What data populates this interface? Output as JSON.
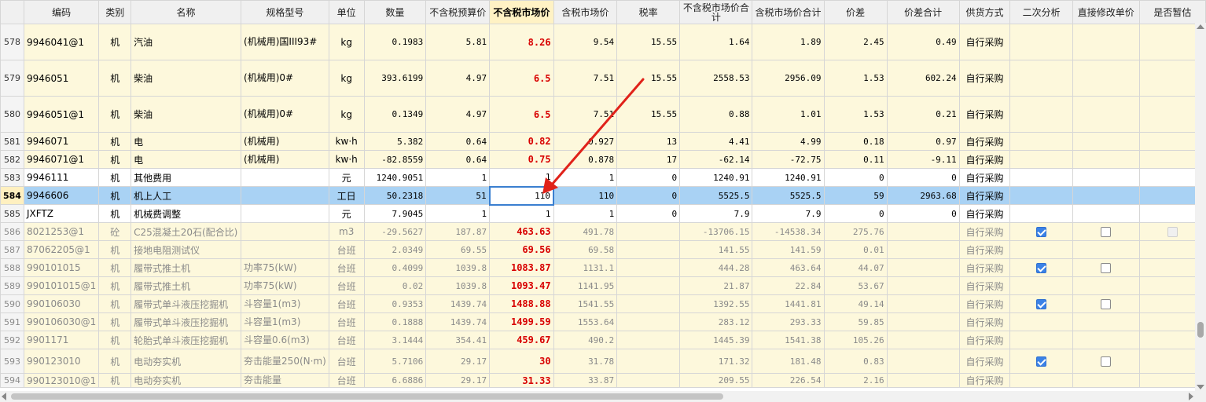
{
  "columns": [
    "编码",
    "类别",
    "名称",
    "规格型号",
    "单位",
    "数量",
    "不含税预算价",
    "不含税市场价",
    "含税市场价",
    "税率",
    "不含税市场价合计",
    "含税市场价合计",
    "价差",
    "价差合计",
    "供货方式",
    "二次分析",
    "直接修改单价",
    "是否暂估"
  ],
  "rows": [
    {
      "n": "578",
      "code": "9946041@1",
      "cat": "机",
      "name": "汽油",
      "spec": "(机械用)国III93#",
      "unit": "kg",
      "qty": "0.1983",
      "budget": "5.81",
      "market": "8.26",
      "taxed": "9.54",
      "rate": "15.55",
      "sum": "1.64",
      "sumtax": "1.89",
      "diff": "2.45",
      "diffsum": "0.49",
      "supply": "自行采购",
      "c1": "",
      "c2": "",
      "c3": ""
    },
    {
      "n": "579",
      "code": "9946051",
      "cat": "机",
      "name": "柴油",
      "spec": "(机械用)0#",
      "unit": "kg",
      "qty": "393.6199",
      "budget": "4.97",
      "market": "6.5",
      "taxed": "7.51",
      "rate": "15.55",
      "sum": "2558.53",
      "sumtax": "2956.09",
      "diff": "1.53",
      "diffsum": "602.24",
      "supply": "自行采购",
      "c1": "",
      "c2": "",
      "c3": ""
    },
    {
      "n": "580",
      "code": "9946051@1",
      "cat": "机",
      "name": "柴油",
      "spec": "(机械用)0#",
      "unit": "kg",
      "qty": "0.1349",
      "budget": "4.97",
      "market": "6.5",
      "taxed": "7.51",
      "rate": "15.55",
      "sum": "0.88",
      "sumtax": "1.01",
      "diff": "1.53",
      "diffsum": "0.21",
      "supply": "自行采购",
      "c1": "",
      "c2": "",
      "c3": ""
    },
    {
      "n": "581",
      "code": "9946071",
      "cat": "机",
      "name": "电",
      "spec": "(机械用)",
      "unit": "kw·h",
      "qty": "5.382",
      "budget": "0.64",
      "market": "0.82",
      "taxed": "0.927",
      "rate": "13",
      "sum": "4.41",
      "sumtax": "4.99",
      "diff": "0.18",
      "diffsum": "0.97",
      "supply": "自行采购",
      "c1": "",
      "c2": "",
      "c3": ""
    },
    {
      "n": "582",
      "code": "9946071@1",
      "cat": "机",
      "name": "电",
      "spec": "(机械用)",
      "unit": "kw·h",
      "qty": "-82.8559",
      "budget": "0.64",
      "market": "0.75",
      "taxed": "0.878",
      "rate": "17",
      "sum": "-62.14",
      "sumtax": "-72.75",
      "diff": "0.11",
      "diffsum": "-9.11",
      "supply": "自行采购",
      "c1": "",
      "c2": "",
      "c3": ""
    },
    {
      "n": "583",
      "code": "9946111",
      "cat": "机",
      "name": "其他费用",
      "spec": "",
      "unit": "元",
      "qty": "1240.9051",
      "budget": "1",
      "market": "1",
      "taxed": "1",
      "rate": "0",
      "sum": "1240.91",
      "sumtax": "1240.91",
      "diff": "0",
      "diffsum": "0",
      "supply": "自行采购",
      "c1": "",
      "c2": "",
      "c3": ""
    },
    {
      "n": "584",
      "code": "9946606",
      "cat": "机",
      "name": "机上人工",
      "spec": "",
      "unit": "工日",
      "qty": "50.2318",
      "budget": "51",
      "market": "110",
      "taxed": "110",
      "rate": "0",
      "sum": "5525.5",
      "sumtax": "5525.5",
      "diff": "59",
      "diffsum": "2963.68",
      "supply": "自行采购",
      "c1": "",
      "c2": "",
      "c3": ""
    },
    {
      "n": "585",
      "code": "JXFTZ",
      "cat": "机",
      "name": "机械费调整",
      "spec": "",
      "unit": "元",
      "qty": "7.9045",
      "budget": "1",
      "market": "1",
      "taxed": "1",
      "rate": "0",
      "sum": "7.9",
      "sumtax": "7.9",
      "diff": "0",
      "diffsum": "0",
      "supply": "自行采购",
      "c1": "",
      "c2": "",
      "c3": ""
    },
    {
      "n": "586",
      "code": "8021253@1",
      "cat": "砼",
      "name": "C25混凝土20石(配合比)",
      "spec": "",
      "unit": "m3",
      "qty": "-29.5627",
      "budget": "187.87",
      "market": "463.63",
      "taxed": "491.78",
      "rate": "",
      "sum": "-13706.15",
      "sumtax": "-14538.34",
      "diff": "275.76",
      "diffsum": "",
      "supply": "自行采购",
      "c1": "on",
      "c2": "off",
      "c3": "dis"
    },
    {
      "n": "587",
      "code": "87062205@1",
      "cat": "机",
      "name": "接地电阻测试仪",
      "spec": "",
      "unit": "台班",
      "qty": "2.0349",
      "budget": "69.55",
      "market": "69.56",
      "taxed": "69.58",
      "rate": "",
      "sum": "141.55",
      "sumtax": "141.59",
      "diff": "0.01",
      "diffsum": "",
      "supply": "自行采购",
      "c1": "",
      "c2": "",
      "c3": ""
    },
    {
      "n": "588",
      "code": "990101015",
      "cat": "机",
      "name": "履带式推土机",
      "spec": "功率75(kW)",
      "unit": "台班",
      "qty": "0.4099",
      "budget": "1039.8",
      "market": "1083.87",
      "taxed": "1131.1",
      "rate": "",
      "sum": "444.28",
      "sumtax": "463.64",
      "diff": "44.07",
      "diffsum": "",
      "supply": "自行采购",
      "c1": "on",
      "c2": "off",
      "c3": ""
    },
    {
      "n": "589",
      "code": "990101015@1",
      "cat": "机",
      "name": "履带式推土机",
      "spec": "功率75(kW)",
      "unit": "台班",
      "qty": "0.02",
      "budget": "1039.8",
      "market": "1093.47",
      "taxed": "1141.95",
      "rate": "",
      "sum": "21.87",
      "sumtax": "22.84",
      "diff": "53.67",
      "diffsum": "",
      "supply": "自行采购",
      "c1": "",
      "c2": "",
      "c3": ""
    },
    {
      "n": "590",
      "code": "990106030",
      "cat": "机",
      "name": "履带式单斗液压挖掘机",
      "spec": "斗容量1(m3)",
      "unit": "台班",
      "qty": "0.9353",
      "budget": "1439.74",
      "market": "1488.88",
      "taxed": "1541.55",
      "rate": "",
      "sum": "1392.55",
      "sumtax": "1441.81",
      "diff": "49.14",
      "diffsum": "",
      "supply": "自行采购",
      "c1": "on",
      "c2": "off",
      "c3": ""
    },
    {
      "n": "591",
      "code": "990106030@1",
      "cat": "机",
      "name": "履带式单斗液压挖掘机",
      "spec": "斗容量1(m3)",
      "unit": "台班",
      "qty": "0.1888",
      "budget": "1439.74",
      "market": "1499.59",
      "taxed": "1553.64",
      "rate": "",
      "sum": "283.12",
      "sumtax": "293.33",
      "diff": "59.85",
      "diffsum": "",
      "supply": "自行采购",
      "c1": "",
      "c2": "",
      "c3": ""
    },
    {
      "n": "592",
      "code": "9901171",
      "cat": "机",
      "name": "轮胎式单斗液压挖掘机",
      "spec": "斗容量0.6(m3)",
      "unit": "台班",
      "qty": "3.1444",
      "budget": "354.41",
      "market": "459.67",
      "taxed": "490.2",
      "rate": "",
      "sum": "1445.39",
      "sumtax": "1541.38",
      "diff": "105.26",
      "diffsum": "",
      "supply": "自行采购",
      "c1": "",
      "c2": "",
      "c3": ""
    },
    {
      "n": "593",
      "code": "990123010",
      "cat": "机",
      "name": "电动夯实机",
      "spec": "夯击能量250(N·m)",
      "unit": "台班",
      "qty": "5.7106",
      "budget": "29.17",
      "market": "30",
      "taxed": "31.78",
      "rate": "",
      "sum": "171.32",
      "sumtax": "181.48",
      "diff": "0.83",
      "diffsum": "",
      "supply": "自行采购",
      "c1": "on",
      "c2": "off",
      "c3": ""
    },
    {
      "n": "594",
      "code": "990123010@1",
      "cat": "机",
      "name": "电动夯实机",
      "spec": "夯击能量",
      "unit": "台班",
      "qty": "6.6886",
      "budget": "29.17",
      "market": "31.33",
      "taxed": "33.87",
      "rate": "",
      "sum": "209.55",
      "sumtax": "226.54",
      "diff": "2.16",
      "diffsum": "",
      "supply": "自行采购",
      "c1": "",
      "c2": "",
      "c3": ""
    }
  ],
  "colors": {
    "selected_row": "#a9d2f4",
    "highlight_header": "#fff2c4",
    "modified_price": "#d80000",
    "row_bg": "#fdf8dc",
    "arrow": "#e0221a"
  }
}
